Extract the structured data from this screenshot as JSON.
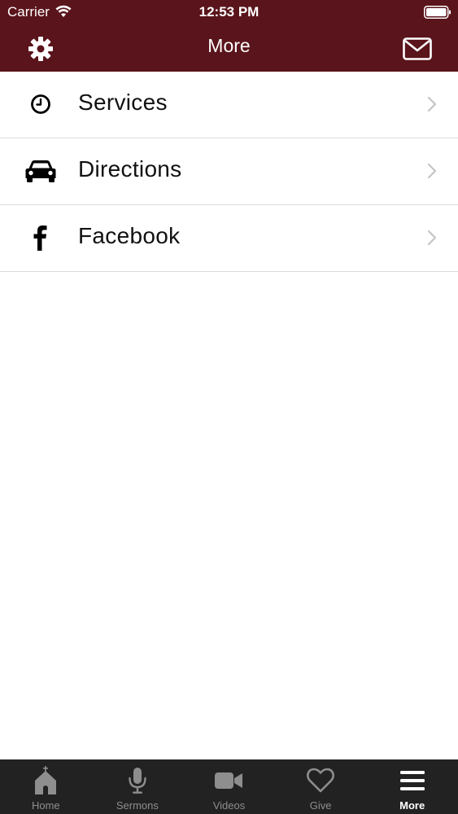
{
  "status_bar": {
    "carrier": "Carrier",
    "time": "12:53 PM"
  },
  "nav": {
    "title": "More",
    "left_icon": "gear-icon",
    "right_icon": "mail-icon"
  },
  "list": {
    "items": [
      {
        "label": "Services",
        "icon": "clock-icon"
      },
      {
        "label": "Directions",
        "icon": "car-icon"
      },
      {
        "label": "Facebook",
        "icon": "facebook-icon"
      }
    ]
  },
  "tabs": {
    "items": [
      {
        "label": "Home",
        "icon": "church-icon",
        "active": false
      },
      {
        "label": "Sermons",
        "icon": "microphone-icon",
        "active": false
      },
      {
        "label": "Videos",
        "icon": "video-camera-icon",
        "active": false
      },
      {
        "label": "Give",
        "icon": "heart-icon",
        "active": false
      },
      {
        "label": "More",
        "icon": "menu-icon",
        "active": true
      }
    ]
  },
  "colors": {
    "header_bg": "#5a141b",
    "tab_bar_bg": "#222222",
    "tab_inactive": "#8e8e8e",
    "tab_active": "#ffffff"
  }
}
